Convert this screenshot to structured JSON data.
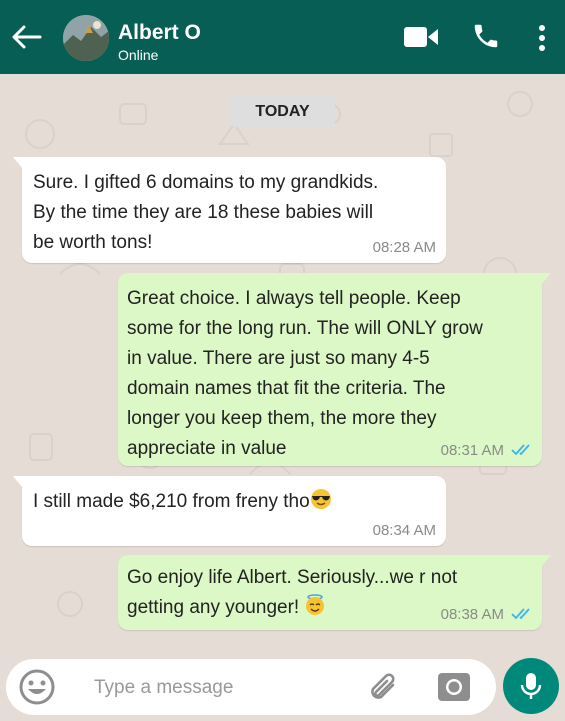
{
  "header": {
    "contact_name": "Albert O",
    "status": "Online",
    "back_icon": "arrow-left-icon",
    "video_icon": "video-call-icon",
    "phone_icon": "phone-call-icon",
    "menu_icon": "more-vertical-icon"
  },
  "date_chip": "TODAY",
  "messages": [
    {
      "direction": "incoming",
      "lines": [
        "Sure. I gifted 6 domains to my grandkids.",
        "By the time they are 18 these babies will",
        "be worth tons!"
      ],
      "time": "08:28 AM"
    },
    {
      "direction": "outgoing",
      "lines": [
        "Great choice. I always tell people. Keep",
        "some for the long run. The will ONLY grow",
        "in value. There are just so many 4-5",
        "domain names that fit the criteria. The",
        "longer you keep them, the more they",
        "appreciate in value"
      ],
      "time": "08:31 AM",
      "status": "read"
    },
    {
      "direction": "incoming",
      "lines": [
        "I still made $6,210 from freny tho"
      ],
      "emoji": "sunglasses-face-emoji",
      "time": "08:34 AM"
    },
    {
      "direction": "outgoing",
      "lines": [
        "Go enjoy life Albert. Seriously...we r not",
        "getting any younger!"
      ],
      "emoji": "halo-face-emoji",
      "time": "08:38 AM",
      "status": "read"
    }
  ],
  "composer": {
    "placeholder": "Type a message",
    "emoji_icon": "emoji-face-icon",
    "attach_icon": "paperclip-icon",
    "camera_icon": "camera-icon",
    "mic_icon": "microphone-icon"
  },
  "colors": {
    "header": "#075e54",
    "chat_background": "#e5ddd5",
    "incoming_bubble": "#ffffff",
    "outgoing_bubble": "#dcf8c6",
    "read_ticks": "#34b7f1",
    "mic_button": "#00897b"
  }
}
